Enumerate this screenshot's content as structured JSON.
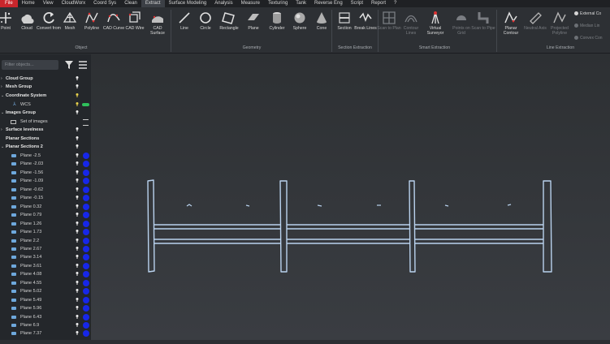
{
  "menu": [
    "File",
    "Home",
    "View",
    "CloudWorx",
    "Coord Sys",
    "Clean",
    "Extract",
    "Surface Modeling",
    "Analysis",
    "Measure",
    "Texturing",
    "Tank",
    "Reverse Eng",
    "Script",
    "Report",
    "?"
  ],
  "menu_active": "File",
  "menu_highlight": "Extract",
  "ribbon": {
    "object": {
      "label": "Object",
      "buttons": [
        "Point",
        "Cloud",
        "Convert from",
        "Mesh",
        "Polyline",
        "CAD Curve",
        "CAD Wire",
        "CAD Surface"
      ]
    },
    "geometry": {
      "label": "Geometry",
      "buttons": [
        "Line",
        "Circle",
        "Rectangle",
        "Plane",
        "Cylinder",
        "Sphere",
        "Cone"
      ]
    },
    "section": {
      "label": "Section Extraction",
      "buttons": [
        "Section",
        "Break Lines"
      ]
    },
    "smart": {
      "label": "Smart Extraction",
      "buttons": [
        "Scan to Plan",
        "Contour Lines",
        "Virtual Surveyor",
        "Points on Grid",
        "Scan to Pipe"
      ]
    },
    "line": {
      "label": "Line Extraction",
      "buttons": [
        "Planar Contour",
        "Neutral Axis",
        "Projected Polyline"
      ],
      "small": [
        "External Co",
        "Median Lin",
        "Convex Con"
      ]
    }
  },
  "tree": {
    "filter_placeholder": "Filter objects...",
    "groups_top": [
      {
        "label": "Cloud Group",
        "level": 0
      },
      {
        "label": "Mesh Group",
        "level": 0
      },
      {
        "label": "Coordinate System",
        "level": 0
      },
      {
        "label": "WCS",
        "level": 1
      },
      {
        "label": "Images Group",
        "level": 0
      },
      {
        "label": "Set of images",
        "level": 1
      },
      {
        "label": "Surface levelness",
        "level": 0
      },
      {
        "label": "Planar Sections",
        "level": 0
      },
      {
        "label": "Planar Sections 2",
        "level": 0
      }
    ],
    "planes": [
      "Plane -2.5",
      "Plane -2.03",
      "Plane -1.56",
      "Plane -1.09",
      "Plane -0.62",
      "Plane -0.15",
      "Plane 0.32",
      "Plane 0.79",
      "Plane 1.26",
      "Plane 1.73",
      "Plane 2.2",
      "Plane 2.67",
      "Plane 3.14",
      "Plane 3.61",
      "Plane 4.08",
      "Plane 4.55",
      "Plane 5.02",
      "Plane 5.49",
      "Plane 5.96",
      "Plane 6.43",
      "Plane 6.9",
      "Plane 7.37"
    ]
  },
  "colors": {
    "accent": "#c8262c",
    "plane_dot": "#1727e8",
    "section_line": "#b9d2ee"
  }
}
